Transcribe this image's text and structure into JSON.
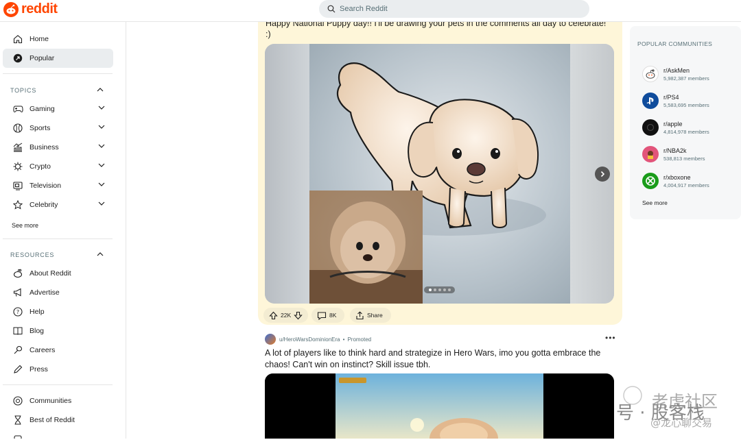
{
  "header": {
    "logo_text": "reddit",
    "search_placeholder": "Search Reddit"
  },
  "sidebar": {
    "main": [
      {
        "label": "Home",
        "icon": "home-icon"
      },
      {
        "label": "Popular",
        "icon": "popular-icon",
        "active": true
      }
    ],
    "topics_heading": "TOPICS",
    "topics": [
      {
        "label": "Gaming",
        "icon": "gamepad-icon"
      },
      {
        "label": "Sports",
        "icon": "sports-icon"
      },
      {
        "label": "Business",
        "icon": "business-icon"
      },
      {
        "label": "Crypto",
        "icon": "crypto-icon"
      },
      {
        "label": "Television",
        "icon": "tv-icon"
      },
      {
        "label": "Celebrity",
        "icon": "star-icon"
      }
    ],
    "topics_see_more": "See more",
    "resources_heading": "RESOURCES",
    "resources": [
      {
        "label": "About Reddit",
        "icon": "reddit-icon"
      },
      {
        "label": "Advertise",
        "icon": "megaphone-icon"
      },
      {
        "label": "Help",
        "icon": "help-icon"
      },
      {
        "label": "Blog",
        "icon": "book-icon"
      },
      {
        "label": "Careers",
        "icon": "wrench-icon"
      },
      {
        "label": "Press",
        "icon": "pen-icon"
      }
    ],
    "extras": [
      {
        "label": "Communities",
        "icon": "communities-icon"
      },
      {
        "label": "Best of Reddit",
        "icon": "hourglass-icon"
      }
    ]
  },
  "post1": {
    "title": "Happy National Puppy day!! I'll be drawing your pets in the comments all day to celebrate! :)",
    "upvotes": "22K",
    "comments": "8K",
    "share_label": "Share",
    "carousel_index": 1,
    "carousel_count": 5
  },
  "post2": {
    "author": "u/HeroWarsDominionEra",
    "separator": "•",
    "promoted_label": "Promoted",
    "title": "A lot of players like to think hard and strategize in Hero Wars, imo you gotta embrace the chaos! Can't win on instinct? Skill issue tbh."
  },
  "rightbar": {
    "title": "POPULAR COMMUNITIES",
    "communities": [
      {
        "name": "r/AskMen",
        "members": "5,982,387 members",
        "color": "#ffffff"
      },
      {
        "name": "r/PS4",
        "members": "5,583,695 members",
        "color": "#0f4c9c"
      },
      {
        "name": "r/apple",
        "members": "4,814,978 members",
        "color": "#111111"
      },
      {
        "name": "r/NBA2k",
        "members": "538,813 members",
        "color": "#e2547a"
      },
      {
        "name": "r/xboxone",
        "members": "4,004,917 members",
        "color": "#1a9c1a"
      }
    ],
    "see_more": "See more"
  },
  "watermark": {
    "line1": "老虎社区",
    "line2": "号 · 股客栈",
    "line3": "@龙心聊交易"
  },
  "colors": {
    "brand": "#ff4500",
    "post_highlight": "#fef6d9"
  }
}
